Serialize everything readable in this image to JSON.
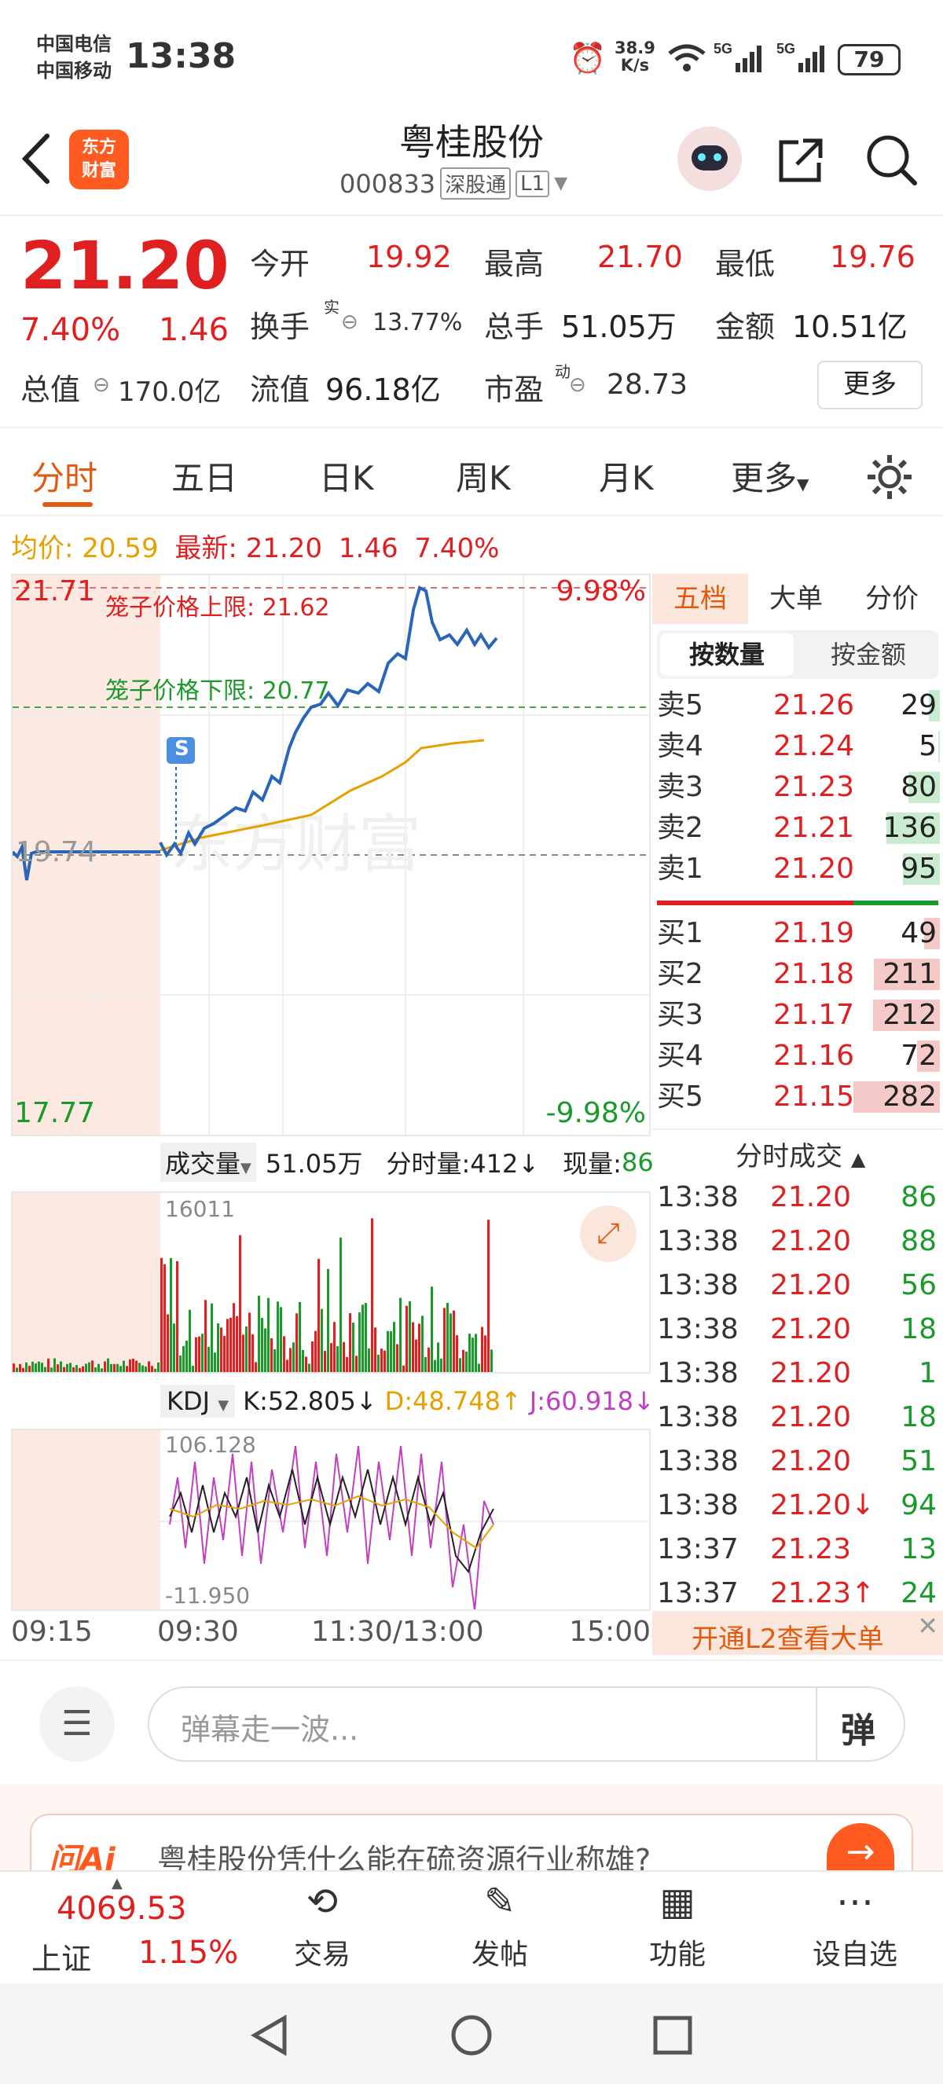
{
  "status": {
    "carrier1": "中国电信",
    "carrier2": "中国移动",
    "time": "13:38",
    "net_speed_top": "38.9",
    "net_speed_unit": "K/s",
    "battery": "79"
  },
  "header": {
    "logo_line1": "东方",
    "logo_line2": "财富",
    "title": "粤桂股份",
    "code": "000833",
    "tag1": "深股通",
    "tag2": "L1"
  },
  "quote": {
    "price": "21.20",
    "change_pct": "7.40%",
    "change_abs": "1.46",
    "open_label": "今开",
    "open": "19.92",
    "high_label": "最高",
    "high": "21.70",
    "low_label": "最低",
    "low": "19.76",
    "turnover_label": "换手",
    "turnover_sup": "实",
    "turnover": "13.77%",
    "volume_label": "总手",
    "volume": "51.05万",
    "amount_label": "金额",
    "amount": "10.51亿",
    "mktcap_label": "总值",
    "mktcap": "170.0亿",
    "float_label": "流值",
    "float": "96.18亿",
    "pe_label": "市盈",
    "pe_sup": "动",
    "pe": "28.73",
    "more": "更多"
  },
  "tabs": [
    "分时",
    "五日",
    "日K",
    "周K",
    "月K",
    "更多"
  ],
  "chart_info": {
    "avg_label": "均价:",
    "avg": "20.59",
    "latest_label": "最新:",
    "latest": "21.20",
    "chg": "1.46",
    "pct": "7.40%",
    "top_price": "21.71",
    "top_pct": "9.98%",
    "bottom_price": "17.77",
    "bottom_pct": "-9.98%",
    "mid_price": "19.74",
    "cage_upper": "笼子价格上限: 21.62",
    "cage_lower": "笼子价格下限: 20.77",
    "watermark": "东方财富",
    "s_marker": "S"
  },
  "volume_panel": {
    "label": "成交量",
    "total": "51.05万",
    "per_min": "分时量:412↓",
    "now_label": "现量:",
    "now": "86",
    "peak": "16011"
  },
  "kdj_panel": {
    "label": "KDJ",
    "k": "K:52.805↓",
    "d": "D:48.748↑",
    "j": "J:60.918↓",
    "max": "106.128",
    "min": "-11.950"
  },
  "time_axis": [
    "09:15",
    "09:30",
    "11:30/13:00",
    "15:00"
  ],
  "orderbook": {
    "tabs": [
      "五档",
      "大单",
      "分价"
    ],
    "subtabs": [
      "按数量",
      "按金额"
    ],
    "asks": [
      {
        "label": "卖5",
        "price": "21.26",
        "vol": "29"
      },
      {
        "label": "卖4",
        "price": "21.24",
        "vol": "5"
      },
      {
        "label": "卖3",
        "price": "21.23",
        "vol": "80"
      },
      {
        "label": "卖2",
        "price": "21.21",
        "vol": "136"
      },
      {
        "label": "卖1",
        "price": "21.20",
        "vol": "95"
      }
    ],
    "bids": [
      {
        "label": "买1",
        "price": "21.19",
        "vol": "49"
      },
      {
        "label": "买2",
        "price": "21.18",
        "vol": "211"
      },
      {
        "label": "买3",
        "price": "21.17",
        "vol": "212"
      },
      {
        "label": "买4",
        "price": "21.16",
        "vol": "72"
      },
      {
        "label": "买5",
        "price": "21.15",
        "vol": "282"
      }
    ],
    "ticks_title": "分时成交",
    "ticks": [
      {
        "t": "13:38",
        "p": "21.20",
        "v": "86"
      },
      {
        "t": "13:38",
        "p": "21.20",
        "v": "88"
      },
      {
        "t": "13:38",
        "p": "21.20",
        "v": "56"
      },
      {
        "t": "13:38",
        "p": "21.20",
        "v": "18"
      },
      {
        "t": "13:38",
        "p": "21.20",
        "v": "1"
      },
      {
        "t": "13:38",
        "p": "21.20",
        "v": "18"
      },
      {
        "t": "13:38",
        "p": "21.20",
        "v": "51"
      },
      {
        "t": "13:38",
        "p": "21.20↓",
        "v": "94"
      },
      {
        "t": "13:37",
        "p": "21.23",
        "v": "13"
      },
      {
        "t": "13:37",
        "p": "21.23↑",
        "v": "24"
      }
    ],
    "promo": "开通L2查看大单"
  },
  "danmaku": {
    "placeholder": "弹幕走一波...",
    "btn": "弹"
  },
  "ai_banner": {
    "logo": "问Ai",
    "question": "粤桂股份凭什么能在硫资源行业称雄?"
  },
  "bottom_nav": {
    "index_val": "4069.53",
    "index_name": "上证",
    "index_pct": "1.15%",
    "items": [
      "交易",
      "发帖",
      "功能",
      "设自选"
    ]
  }
}
